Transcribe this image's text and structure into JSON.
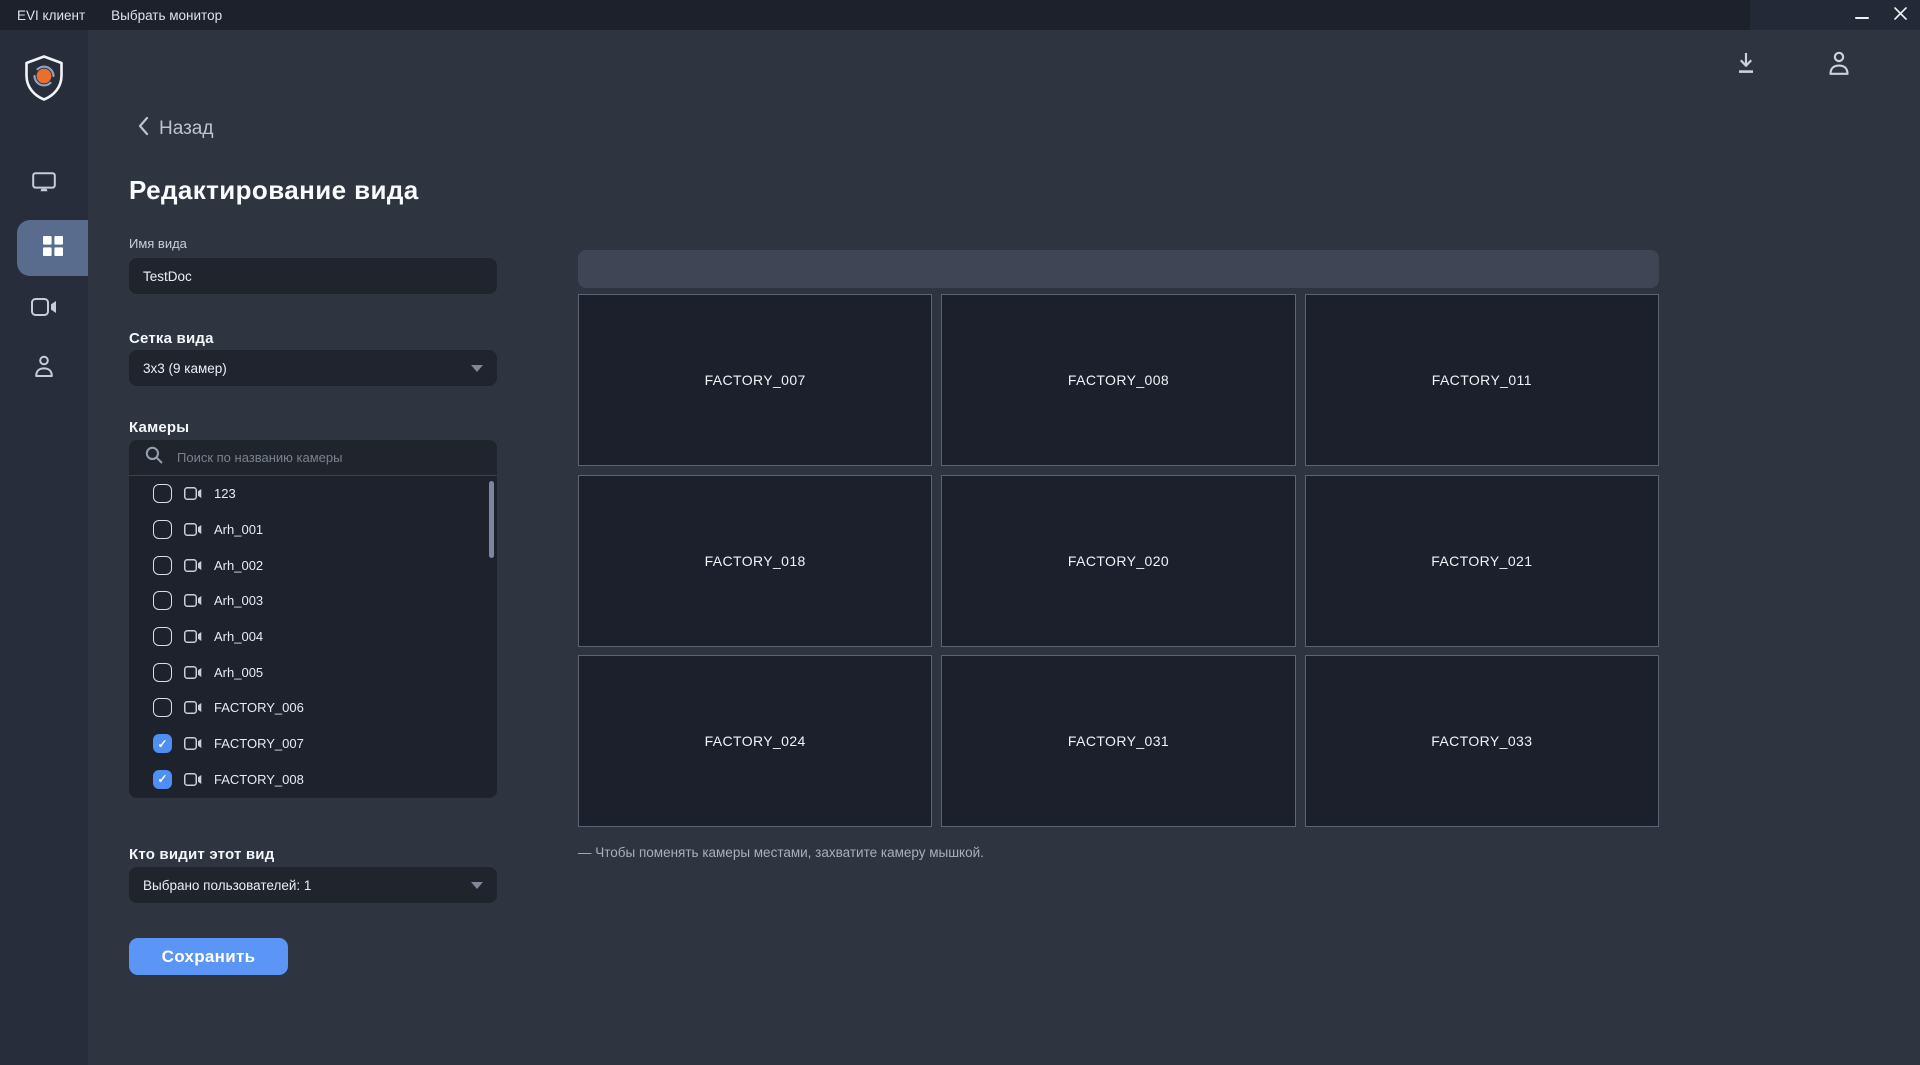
{
  "titlebar": {
    "menus": [
      {
        "label": "EVI клиент"
      },
      {
        "label": "Выбрать монитор"
      }
    ],
    "window_controls": {
      "minimize": "minimize-icon",
      "close": "close-icon"
    }
  },
  "sidebar": {
    "logo": "evi-shield-logo",
    "items": [
      {
        "icon": "monitor-icon",
        "active": false
      },
      {
        "icon": "grid-views-icon",
        "active": true
      },
      {
        "icon": "video-camera-icon",
        "active": false
      },
      {
        "icon": "user-icon",
        "active": false
      }
    ]
  },
  "header": {
    "back_label": "Назад",
    "title": "Редактирование вида",
    "icons": [
      "download-icon",
      "account-icon"
    ]
  },
  "form": {
    "name_field": {
      "label": "Имя вида",
      "value": "TestDoc"
    },
    "grid_field": {
      "label": "Сетка вида",
      "value": "3x3 (9 камер)"
    },
    "cameras_field": {
      "label": "Камеры",
      "search_placeholder": "Поиск по названию камеры",
      "items": [
        {
          "name": "123",
          "checked": false
        },
        {
          "name": "Arh_001",
          "checked": false
        },
        {
          "name": "Arh_002",
          "checked": false
        },
        {
          "name": "Arh_003",
          "checked": false
        },
        {
          "name": "Arh_004",
          "checked": false
        },
        {
          "name": "Arh_005",
          "checked": false
        },
        {
          "name": "FACTORY_006",
          "checked": false
        },
        {
          "name": "FACTORY_007",
          "checked": true
        },
        {
          "name": "FACTORY_008",
          "checked": true
        }
      ]
    },
    "visibility_field": {
      "label": "Кто видит этот вид",
      "value": "Выбрано пользователей: 1"
    },
    "save_button": "Сохранить"
  },
  "preview": {
    "tiles": [
      "FACTORY_007",
      "FACTORY_008",
      "FACTORY_011",
      "FACTORY_018",
      "FACTORY_020",
      "FACTORY_021",
      "FACTORY_024",
      "FACTORY_031",
      "FACTORY_033"
    ],
    "hint": "— Чтобы поменять камеры местами, захватите камеру мышкой."
  },
  "colors": {
    "accent": "#4f8ef2",
    "save": "#5b96f6",
    "active_nav": "#5a6c8e",
    "logo_orange": "#e8702f"
  }
}
